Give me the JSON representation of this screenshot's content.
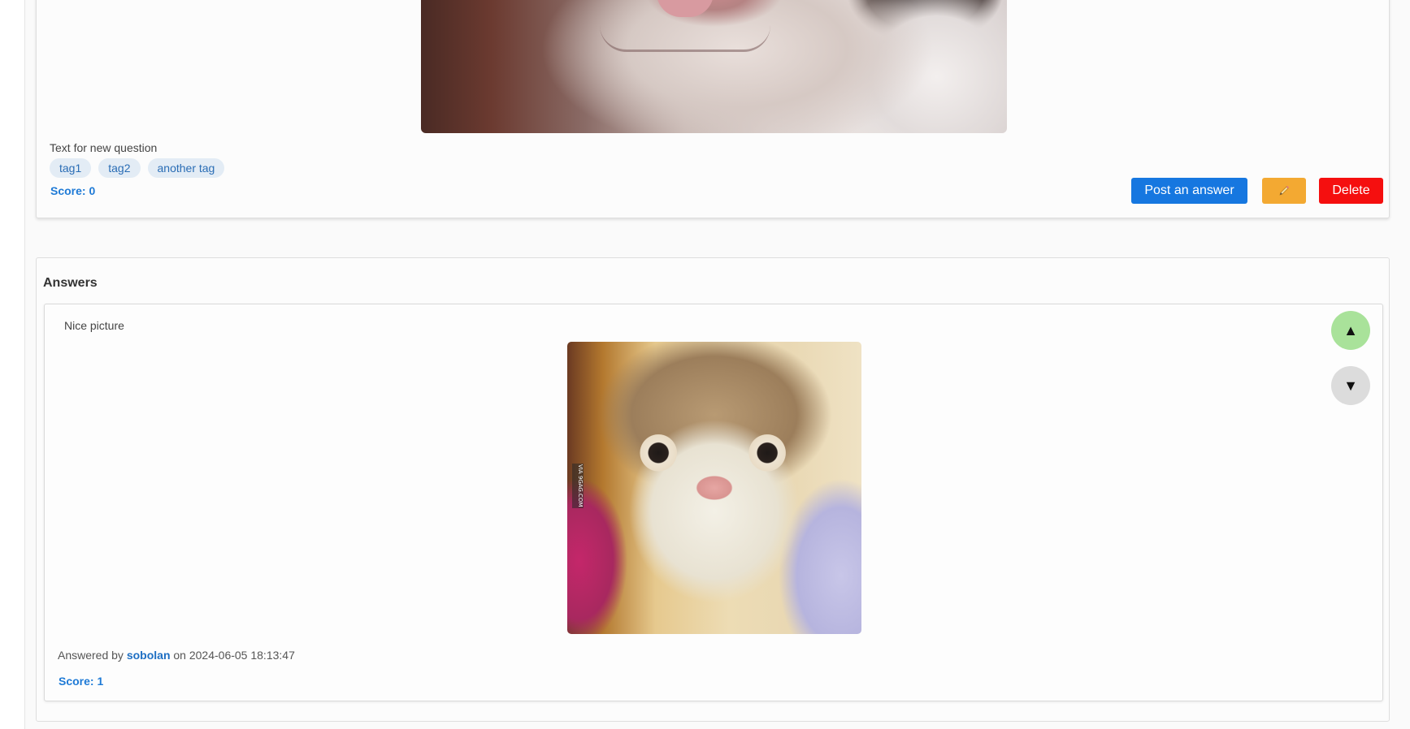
{
  "question": {
    "text": "Text for new question",
    "tags": [
      "tag1",
      "tag2",
      "another tag"
    ],
    "score_label": "Score: 0",
    "actions": {
      "post_answer_label": "Post an answer",
      "edit_icon": "pencil-icon",
      "delete_label": "Delete"
    },
    "image_subject": "cat-smiling-image"
  },
  "answers": {
    "heading": "Answers",
    "items": [
      {
        "text": "Nice picture",
        "image_subject": "smiling-cat-image",
        "watermark": "VIA 9GAG.COM",
        "meta_prefix": "Answered by",
        "author": "sobolan",
        "meta_on": "on",
        "timestamp": "2024-06-05 18:13:47",
        "score_label": "Score: 1",
        "upvote_glyph": "▲",
        "downvote_glyph": "▼"
      }
    ]
  },
  "colors": {
    "primary": "#1677e0",
    "warning": "#f3a932",
    "danger": "#f50f0f",
    "upvote_active": "#a9e29a",
    "vote_neutral": "#dcdcdc",
    "tag_bg": "#e3ecf5",
    "link": "#1e7ad6"
  }
}
